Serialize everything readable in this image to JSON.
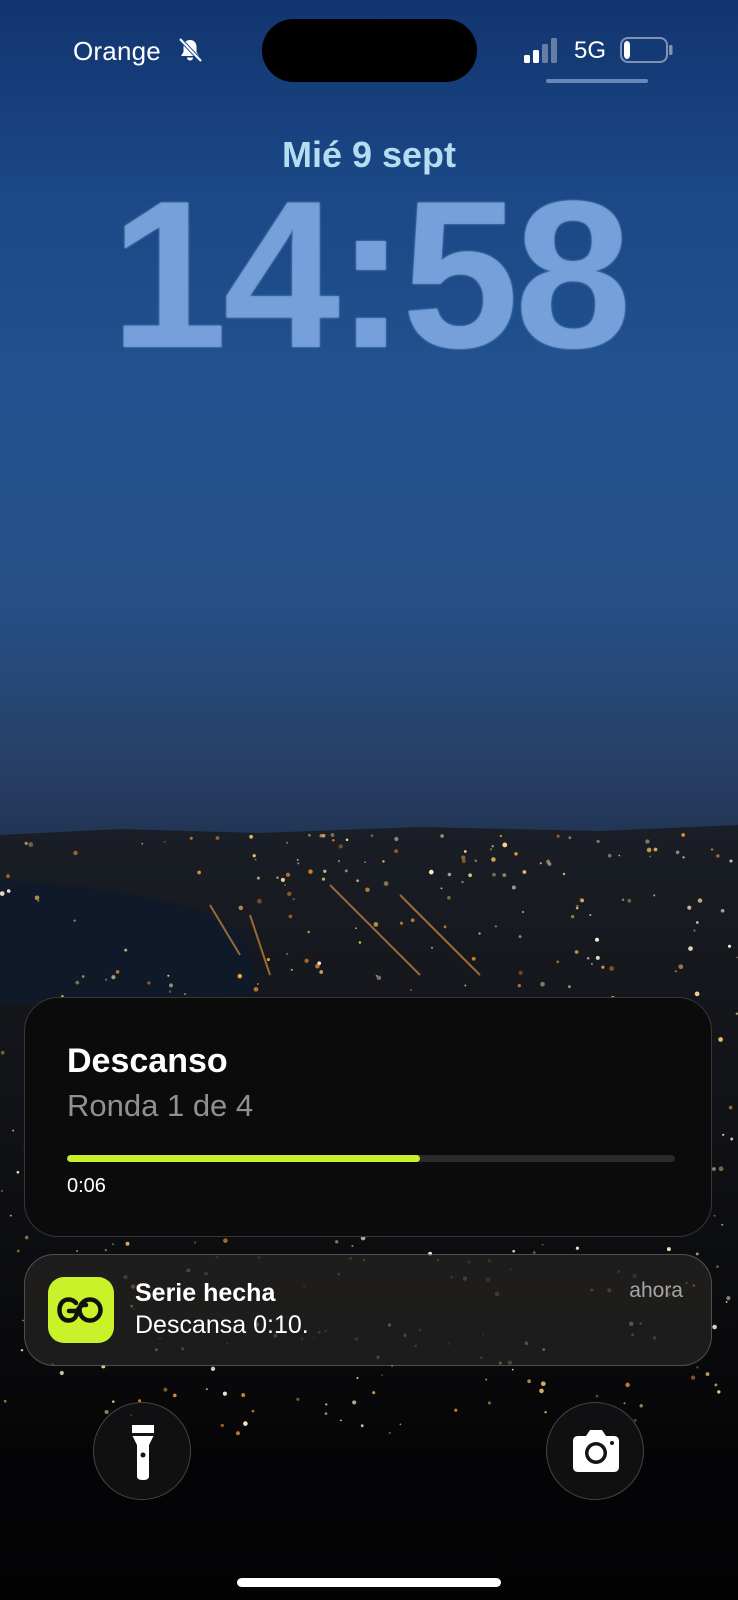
{
  "status_bar": {
    "carrier": "Orange",
    "mute_icon": "bell-slash-icon",
    "signal_icon": "cellular-signal-icon",
    "signal_bars_active": 2,
    "network": "5G",
    "battery_icon": "battery-icon",
    "battery_level": 0.15
  },
  "lockscreen": {
    "date": "Mié 9 sept",
    "time": "14:58"
  },
  "live_activity": {
    "title": "Descanso",
    "subtitle": "Ronda 1 de 4",
    "progress": 0.58,
    "elapsed": "0:06",
    "accent_color": "#c8f02a"
  },
  "notification": {
    "app_icon": "go-app-icon",
    "title": "Serie hecha",
    "body": "Descansa 0:10.",
    "time": "ahora",
    "icon_color": "#c9f22b"
  },
  "quick_actions": {
    "left_icon": "flashlight-icon",
    "right_icon": "camera-icon"
  }
}
